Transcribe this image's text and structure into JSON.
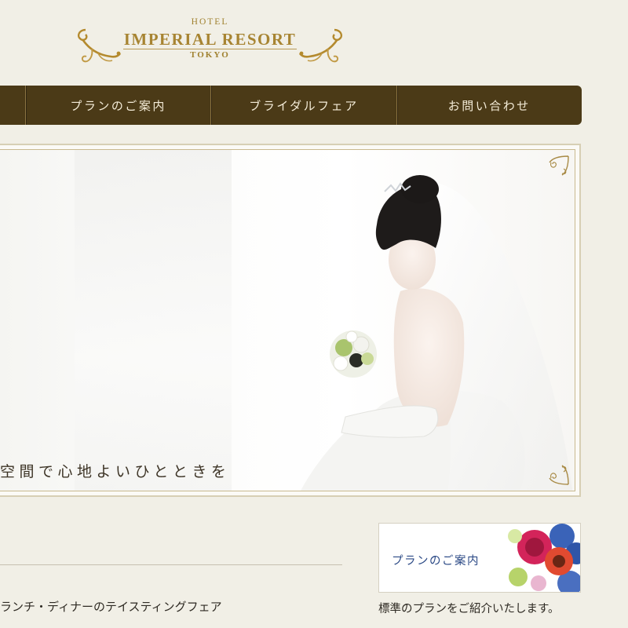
{
  "logo": {
    "hotel": "HOTEL",
    "name": "IMPERIAL RESORT",
    "city": "TOKYO",
    "ornament_icon": "gold-scroll-ornament-icon"
  },
  "nav": {
    "items": [
      {
        "label": ""
      },
      {
        "label": "プランのご案内"
      },
      {
        "label": "ブライダルフェア"
      },
      {
        "label": "お問い合わせ"
      }
    ]
  },
  "hero": {
    "caption": "空間で心地よいひとときを",
    "image": "bride-with-veil-and-bouquet",
    "corner_icon": "ornament-corner-icon"
  },
  "fair": {
    "title": "ランチ・ディナーのテイスティングフェア"
  },
  "plan_banner": {
    "label": "プランのご案内",
    "image": "flower-bouquet",
    "description": "標準のプランをご紹介いたします。"
  },
  "colors": {
    "background": "#f1efe6",
    "nav": "#4b3a17",
    "gold": "#a78432",
    "banner_label": "#2c4a86"
  }
}
